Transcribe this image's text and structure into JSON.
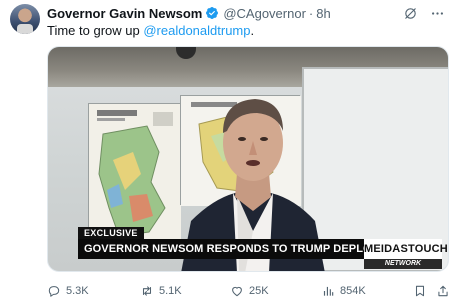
{
  "tweet": {
    "display_name": "Governor Gavin Newsom",
    "handle": "@CAgovernor",
    "separator": "·",
    "time": "8h",
    "text_prefix": "Time to grow up ",
    "mention": "@realdonaldtrump",
    "text_suffix": "."
  },
  "media": {
    "chyron_tag": "EXCLUSIVE",
    "chyron_headline": "GOVERNOR NEWSOM RESPONDS TO TRUMP DEPLOYING MARINES",
    "brand": "MEIDASTOUCH",
    "brand_sub": "NETWORK"
  },
  "actions": {
    "replies": "5.3K",
    "reposts": "5.1K",
    "likes": "25K",
    "views": "854K"
  },
  "icons": {
    "verified": "verified-badge-icon",
    "grok": "grok-icon",
    "more": "more-icon",
    "reply": "reply-icon",
    "repost": "repost-icon",
    "like": "heart-icon",
    "views": "views-icon",
    "bookmark": "bookmark-icon",
    "share": "share-icon"
  },
  "colors": {
    "accent": "#1d9bf0",
    "muted": "#536471",
    "text": "#0f1419"
  }
}
